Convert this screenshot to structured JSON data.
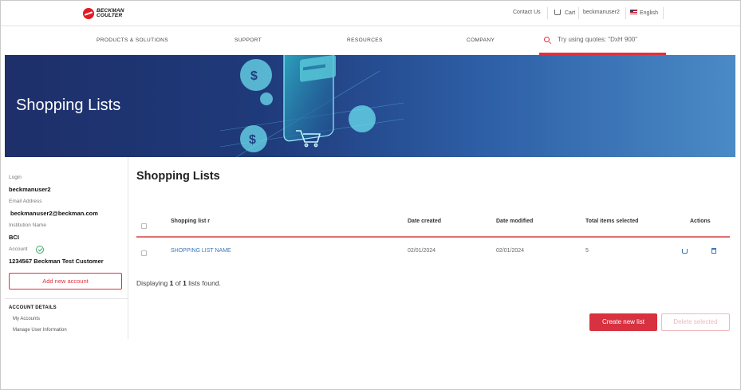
{
  "brand": {
    "line1": "BECKMAN",
    "line2": "COULTER"
  },
  "utility": {
    "contact": "Contact Us",
    "cart": "Cart",
    "user": "beckmanuser2",
    "language": "English"
  },
  "nav": [
    "PRODUCTS & SOLUTIONS",
    "SUPPORT",
    "RESOURCES",
    "COMPANY"
  ],
  "search": {
    "placeholder": "Try using quotes: \"DxH 900\""
  },
  "hero": {
    "title": "Shopping Lists"
  },
  "sidebar": {
    "login_label": "Login",
    "login_value": "beckmanuser2",
    "email_label": "Email Address",
    "email_value": "beckmanuser2@beckman.com",
    "institution_label": "Institution Name",
    "institution_value": "BCI",
    "account_label": "Account",
    "account_value": "1234567 Beckman Test Customer",
    "add_account": "Add new account",
    "section_title": "ACCOUNT DETAILS",
    "links": [
      "My Accounts",
      "Manage User Information"
    ]
  },
  "main": {
    "title": "Shopping Lists",
    "columns": [
      "Shopping list r",
      "Date created",
      "Date modified",
      "Total items selected",
      "Actions"
    ],
    "rows": [
      {
        "name": "SHOPPING LIST NAME",
        "created": "02/01/2024",
        "modified": "02/01/2024",
        "total": "5"
      }
    ],
    "displaying": {
      "prefix": "Displaying",
      "from": "1",
      "of_word": "of",
      "total": "1",
      "suffix": "lists found."
    },
    "create_button": "Create new list",
    "delete_button": "Delete selected"
  },
  "colors": {
    "accent": "#d8313f",
    "link": "#3a78b8",
    "hero_dark": "#1e2f6a",
    "hero_light": "#4a8ac6"
  }
}
